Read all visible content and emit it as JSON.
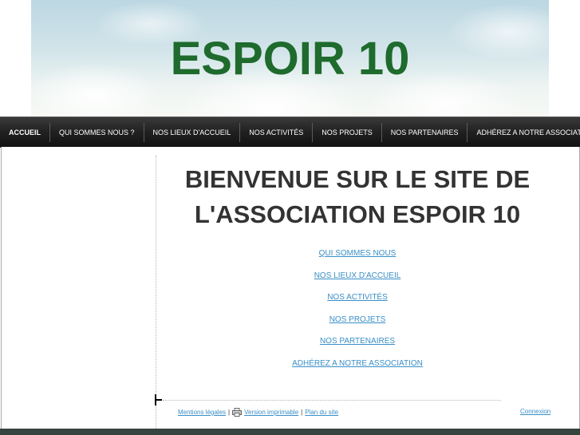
{
  "banner": {
    "title": "ESPOIR 10"
  },
  "nav": {
    "items": [
      {
        "label": "ACCUEIL",
        "active": true
      },
      {
        "label": "QUI SOMMES NOUS ?"
      },
      {
        "label": "NOS LIEUX D'ACCUEIL"
      },
      {
        "label": "NOS ACTIVITÉS"
      },
      {
        "label": "NOS PROJETS"
      },
      {
        "label": "NOS PARTENAIRES"
      },
      {
        "label": "ADHÉREZ A NOTRE ASSOCIATION"
      }
    ]
  },
  "main": {
    "heading_line1": "BIENVENUE SUR LE SITE DE",
    "heading_line2": "L'ASSOCIATION ESPOIR 10",
    "links": [
      "QUI SOMMES NOUS",
      "NOS LIEUX D'ACCUEIL",
      "NOS ACTIVITÉS",
      "NOS PROJETS",
      "NOS PARTENAIRES",
      "ADHÉREZ A NOTRE ASSOCIATION"
    ]
  },
  "footer": {
    "legal": "Mentions légales",
    "separator": "|",
    "print": "Version imprimable",
    "sitemap": "Plan du site",
    "login": "Connexion",
    "printer_icon": "printer-icon"
  },
  "colors": {
    "brand_green": "#1e6b2d",
    "link_blue": "#3a8fc7",
    "nav_bg": "#222222",
    "bottom_bar": "#35443d"
  }
}
